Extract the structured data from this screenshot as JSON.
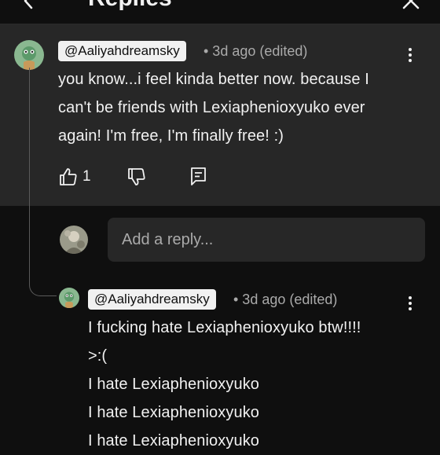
{
  "header": {
    "title": "Replies",
    "back_icon": "chevron-left-icon",
    "close_icon": "close-icon"
  },
  "comment": {
    "author": "@Aaliyahdreamsky",
    "meta": "• 3d ago (edited)",
    "lines": [
      "you know...i feel kinda better now. because I",
      "can't be friends with Lexiaphenioxyuko ever",
      "again! I'm free, I'm finally free! :)"
    ],
    "like_count": "1",
    "icons": [
      "like-icon",
      "dislike-icon",
      "reply-icon",
      "more-vertical-icon"
    ]
  },
  "reply_box": {
    "placeholder": "Add a reply..."
  },
  "reply": {
    "author": "@Aaliyahdreamsky",
    "meta": "• 3d ago (edited)",
    "lines": [
      "I fucking hate Lexiaphenioxyuko btw!!!!",
      ">:(",
      "I hate Lexiaphenioxyuko",
      "I hate Lexiaphenioxyuko",
      "I hate Lexiaphenioxyuko"
    ]
  },
  "colors": {
    "background": "#0f0f0f",
    "comment_background": "#272727",
    "text": "#f1f1f1",
    "secondary_text": "#aaaaaa",
    "handle_badge": "#f1f1f1"
  }
}
